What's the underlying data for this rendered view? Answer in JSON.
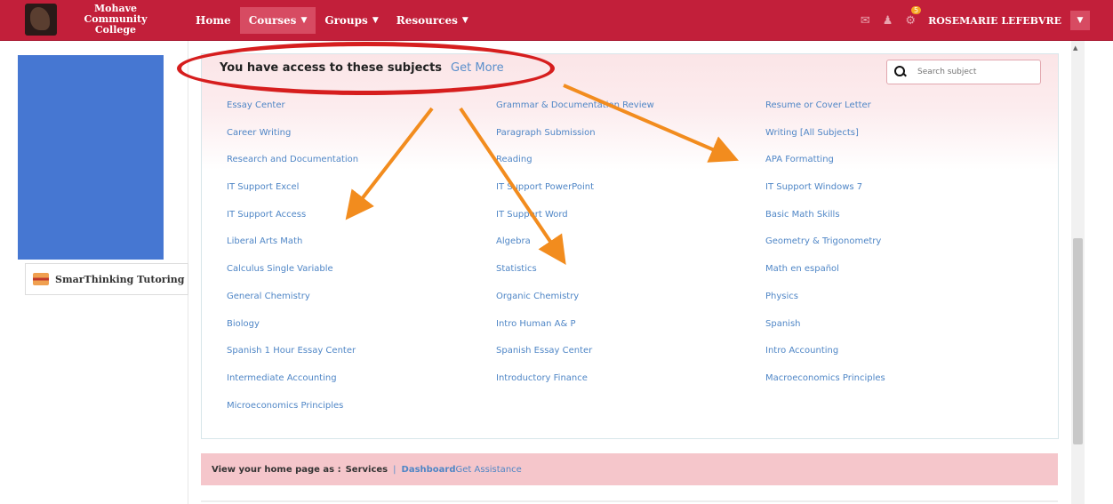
{
  "header": {
    "logo_text": "Mohave Community College",
    "nav": [
      {
        "label": "Home",
        "caret": ""
      },
      {
        "label": "Courses",
        "caret": "▼"
      },
      {
        "label": "Groups",
        "caret": "▼"
      },
      {
        "label": "Resources",
        "caret": "▼"
      }
    ],
    "notification_count": "5",
    "user_name": "ROSEMARIE LEFEBVRE"
  },
  "sidebar": {
    "tutoring_label": "SmarThinking Tutoring"
  },
  "panel": {
    "title": "You have access to these subjects",
    "get_more": "Get More",
    "search_placeholder": "Search subject",
    "subjects": [
      "Essay Center",
      "Grammar & Documentation Review",
      "Resume or Cover Letter",
      "Career Writing",
      "Paragraph Submission",
      "Writing [All Subjects]",
      "Research and Documentation",
      "Reading",
      "APA Formatting",
      "IT Support Excel",
      "IT Support PowerPoint",
      "IT Support Windows 7",
      "IT Support Access",
      "IT Support Word",
      "Basic Math Skills",
      "Liberal Arts Math",
      "Algebra",
      "Geometry & Trigonometry",
      "Calculus Single Variable",
      "Statistics",
      "Math en español",
      "General Chemistry",
      "Organic Chemistry",
      "Physics",
      "Biology",
      "Intro Human A& P",
      "Spanish",
      "Spanish 1 Hour Essay Center",
      "Spanish Essay Center",
      "Intro Accounting",
      "Intermediate Accounting",
      "Introductory Finance",
      "Macroeconomics Principles",
      "Microeconomics Principles"
    ]
  },
  "footer_bar": {
    "label": "View your home page as :",
    "option_services": "Services",
    "separator": "|",
    "option_dashboard": "Dashboard",
    "get_assistance": "Get Assistance"
  },
  "colors": {
    "topbar": "#c21f3a",
    "link": "#4f86c6",
    "annotation_red": "#d61e1e",
    "annotation_orange": "#f28c1e",
    "sidebar_block": "#4677d2"
  }
}
